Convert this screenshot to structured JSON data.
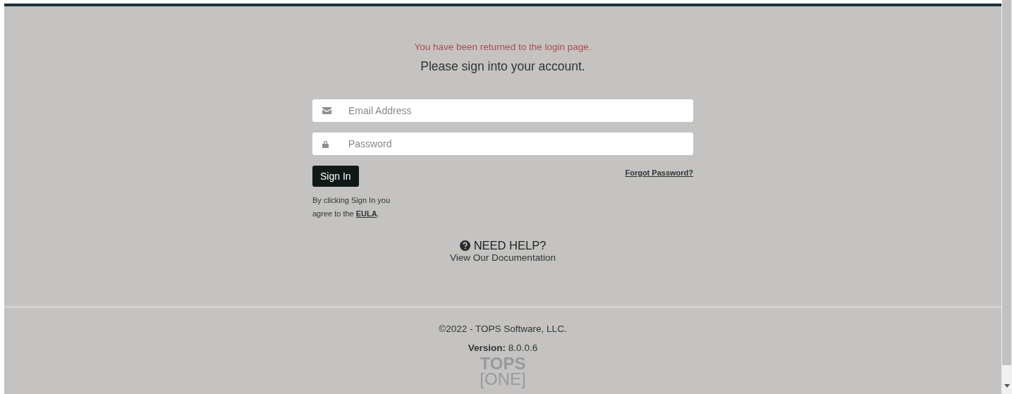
{
  "alert": "You have been returned to the login page.",
  "heading": "Please sign into your account.",
  "fields": [
    {
      "kind": "email",
      "placeholder": "Email Address"
    },
    {
      "kind": "password",
      "placeholder": "Password"
    }
  ],
  "sign_in_button": "Sign In",
  "forgot_link": "Forgot Password?",
  "eula": {
    "text": "By clicking Sign In you agree to the",
    "link": "EULA",
    "end": "."
  },
  "help": {
    "title": "NEED HELP?",
    "link": "View Our Documentation"
  },
  "footer": {
    "copyright": "©2022 - TOPS Software, LLC.",
    "version_label": "Version:",
    "version": "8.0.0.6",
    "logo_top": "TOPS",
    "logo_bottom": "[ONE]"
  }
}
